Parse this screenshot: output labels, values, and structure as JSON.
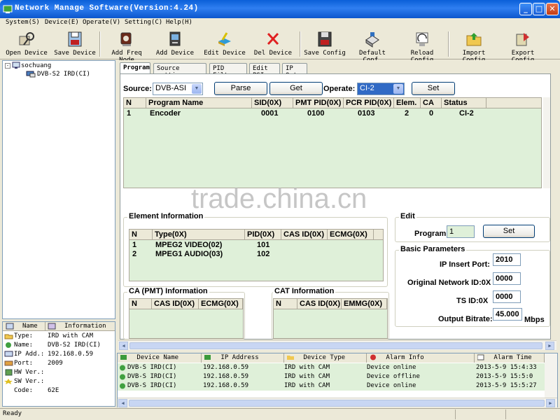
{
  "window": {
    "title": "Network Manage Software(Version:4.24)"
  },
  "menu": [
    "System(S)",
    "Device(E)",
    "Operate(V)",
    "Setting(C)",
    "Help(H)"
  ],
  "toolbar": {
    "open_device": "Open Device",
    "save_device": "Save Device",
    "add_freq_node": "Add Freq Node",
    "add_device": "Add Device",
    "edit_device": "Edit Device",
    "del_device": "Del Device",
    "save_config": "Save Config",
    "default_conf": "Default Conf.",
    "reload_config": "Reload Config",
    "import_config": "Import Config",
    "export_config": "Export Config"
  },
  "tree": {
    "root": "sochuang",
    "child": "DVB-S2 IRD(CI)"
  },
  "properties": {
    "headers": {
      "name": "Name",
      "info": "Information"
    },
    "rows": [
      {
        "label": "Type:",
        "value": "IRD with CAM"
      },
      {
        "label": "Name:",
        "value": "DVB-S2 IRD(CI)"
      },
      {
        "label": "IP Add.:",
        "value": "192.168.0.59"
      },
      {
        "label": "Port:",
        "value": "2009"
      },
      {
        "label": "HW Ver.:",
        "value": ""
      },
      {
        "label": "SW Ver.:",
        "value": ""
      },
      {
        "label": "Code:",
        "value": "62E"
      }
    ]
  },
  "tabs": [
    "Program",
    "Source setting",
    "PID Filter",
    "Edit PSI",
    "IP Out"
  ],
  "program": {
    "source_label": "Source:",
    "source_value": "DVB-ASI",
    "parse_label": "Parse",
    "get_label": "Get",
    "operate_label": "Operate:",
    "operate_value": "CI-2",
    "set_label": "Set",
    "columns": [
      "N",
      "Program Name",
      "SID(0X)",
      "PMT PID(0X)",
      "PCR PID(0X)",
      "Elem.",
      "CA",
      "Status"
    ],
    "rows": [
      [
        "1",
        "Encoder",
        "0001",
        "0100",
        "0103",
        "2",
        "0",
        "CI-2"
      ]
    ]
  },
  "element_info": {
    "title": "Element Information",
    "columns": [
      "N",
      "Type(0X)",
      "PID(0X)",
      "CAS ID(0X)",
      "ECMG(0X)"
    ],
    "rows": [
      [
        "1",
        "MPEG2 VIDEO(02)",
        "101",
        "",
        ""
      ],
      [
        "2",
        "MPEG1 AUDIO(03)",
        "102",
        "",
        ""
      ]
    ]
  },
  "ca_info": {
    "title": "CA (PMT) Information",
    "columns": [
      "N",
      "CAS ID(0X)",
      "ECMG(0X)"
    ]
  },
  "cat_info": {
    "title": "CAT Information",
    "columns": [
      "N",
      "CAS ID(0X)",
      "EMMG(0X)"
    ]
  },
  "edit": {
    "title": "Edit",
    "program_label": "Program",
    "program_value": "1",
    "set_label": "Set"
  },
  "basic": {
    "title": "Basic Parameters",
    "ip_insert_port_label": "IP Insert Port:",
    "ip_insert_port": "2010",
    "onid_label": "Original Network ID:0X",
    "onid": "0000",
    "tsid_label": "TS ID:0X",
    "tsid": "0000",
    "bitrate_label": "Output Bitrate:",
    "bitrate": "45.000",
    "bitrate_unit": "Mbps"
  },
  "alarms": {
    "columns": [
      "Device Name",
      "IP Address",
      "Device Type",
      "Alarm Info",
      "Alarm Time"
    ],
    "rows": [
      [
        "DVB-S IRD(CI)",
        "192.168.0.59",
        "IRD with CAM",
        "Device online",
        "2013-5-9 15:4:33"
      ],
      [
        "DVB-S IRD(CI)",
        "192.168.0.59",
        "IRD with CAM",
        "Device offline",
        "2013-5-9 15:5:0"
      ],
      [
        "DVB-S IRD(CI)",
        "192.168.0.59",
        "IRD with CAM",
        "Device online",
        "2013-5-9 15:5:27"
      ]
    ]
  },
  "status": {
    "text": "Ready"
  },
  "watermark": "trade.china.cn"
}
